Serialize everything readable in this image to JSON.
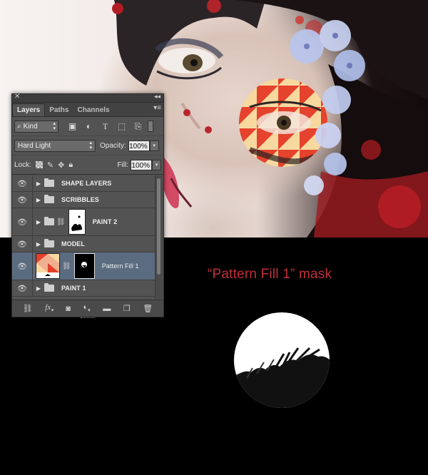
{
  "panel": {
    "tabs": [
      {
        "label": "Layers",
        "active": true
      },
      {
        "label": "Paths",
        "active": false
      },
      {
        "label": "Channels",
        "active": false
      }
    ],
    "filter": {
      "kind_label": "Kind"
    },
    "blend_mode": "Hard Light",
    "opacity_label": "Opacity:",
    "opacity_value": "100%",
    "lock_label": "Lock:",
    "fill_label": "Fill:",
    "fill_value": "100%",
    "layers": [
      {
        "name": "SHAPE LAYERS",
        "type": "group",
        "visible": true
      },
      {
        "name": "SCRIBBLES",
        "type": "group",
        "visible": true
      },
      {
        "name": "PAINT 2",
        "type": "group",
        "visible": true,
        "has_mask": true
      },
      {
        "name": "MODEL",
        "type": "group",
        "visible": true
      },
      {
        "name": "Pattern Fill 1",
        "type": "fill",
        "visible": true,
        "selected": true,
        "has_mask": true
      },
      {
        "name": "PAINT 1",
        "type": "group",
        "visible": true
      }
    ],
    "footer_icons": [
      "link-icon",
      "fx-icon",
      "add-mask-icon",
      "adjustment-icon",
      "new-group-icon",
      "new-layer-icon",
      "trash-icon"
    ]
  },
  "mask_caption": "“Pattern Fill 1” mask",
  "colors": {
    "panel_bg": "#535353",
    "selected_row": "#5b6b80",
    "caption_red": "#c0303a"
  }
}
